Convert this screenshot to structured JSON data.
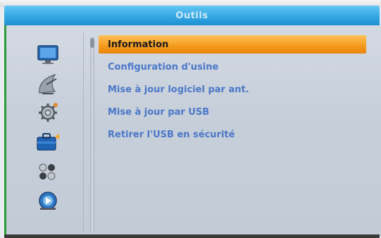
{
  "window": {
    "title": "Outils"
  },
  "sidebar": {
    "icons": [
      {
        "name": "tv-monitor-icon"
      },
      {
        "name": "satellite-dish-icon"
      },
      {
        "name": "settings-gear-icon"
      },
      {
        "name": "toolbox-icon",
        "selected": true
      },
      {
        "name": "games-icon"
      },
      {
        "name": "media-player-icon"
      }
    ]
  },
  "menu": {
    "items": [
      {
        "label": "Information",
        "selected": true
      },
      {
        "label": "Configuration d'usine"
      },
      {
        "label": "Mise à jour logiciel par ant."
      },
      {
        "label": "Mise à jour par USB"
      },
      {
        "label": "Retirer l'USB en sécurité"
      }
    ]
  },
  "colors": {
    "title_bar": "#34a7e3",
    "selection": "#f39a1a",
    "item_text": "#4a78c8"
  }
}
